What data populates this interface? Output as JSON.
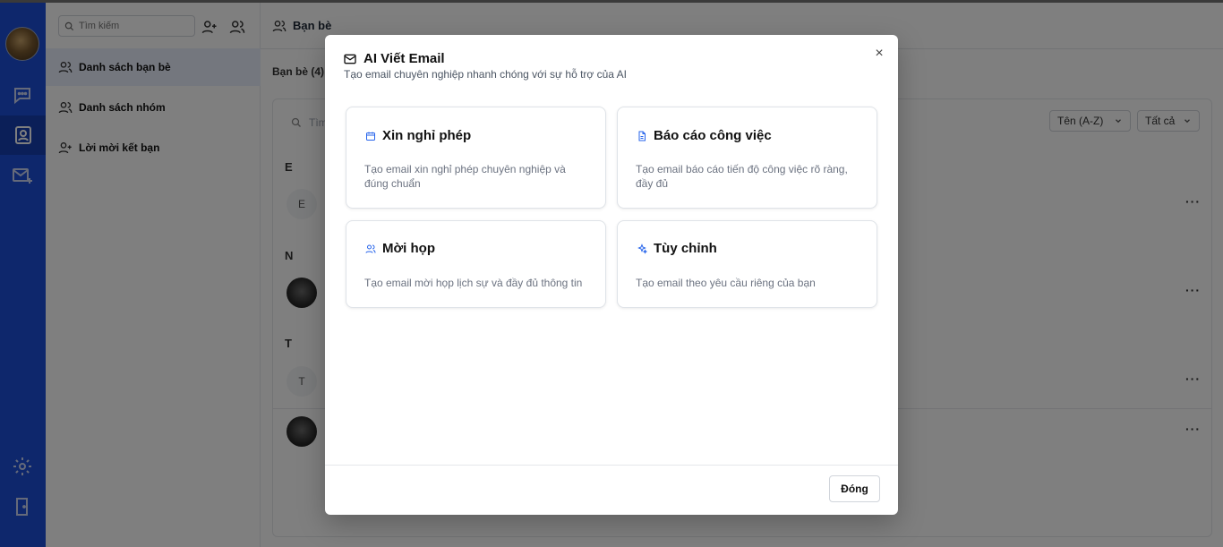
{
  "sidebar": {
    "search_placeholder": "Tìm kiếm",
    "items": [
      {
        "label": "Danh sách bạn bè"
      },
      {
        "label": "Danh sách nhóm"
      },
      {
        "label": "Lời mời kết bạn"
      }
    ]
  },
  "main": {
    "header_title": "Bạn bè",
    "count_label": "Bạn bè (4)",
    "search_placeholder": "Tìm",
    "sort_label": "Tên (A-Z)",
    "filter_label": "Tất cả",
    "groups": [
      {
        "letter": "E",
        "contacts": [
          {
            "initial": "E"
          }
        ]
      },
      {
        "letter": "N",
        "contacts": [
          {
            "initial": ""
          }
        ]
      },
      {
        "letter": "T",
        "contacts": [
          {
            "initial": "T"
          },
          {
            "initial": ""
          }
        ]
      }
    ],
    "more_label": "···"
  },
  "modal": {
    "title": "AI Viết Email",
    "subtitle": "Tạo email chuyên nghiệp nhanh chóng với sự hỗ trợ của AI",
    "close_symbol": "×",
    "cards": [
      {
        "title": "Xin nghỉ phép",
        "description": "Tạo email xin nghỉ phép chuyên nghiệp và đúng chuẩn",
        "icon": "calendar-icon"
      },
      {
        "title": "Báo cáo công việc",
        "description": "Tạo email báo cáo tiến độ công việc rõ ràng, đầy đủ",
        "icon": "document-icon"
      },
      {
        "title": "Mời họp",
        "description": "Tạo email mời họp lịch sự và đầy đủ thông tin",
        "icon": "users-icon"
      },
      {
        "title": "Tùy chỉnh",
        "description": "Tạo email theo yêu cầu riêng của bạn",
        "icon": "sparkles-icon"
      }
    ],
    "footer_button": "Đóng"
  },
  "colors": {
    "rail": "#1d4ed8",
    "accent": "#2563eb",
    "overlay": "rgba(0,0,0,0.5)"
  }
}
